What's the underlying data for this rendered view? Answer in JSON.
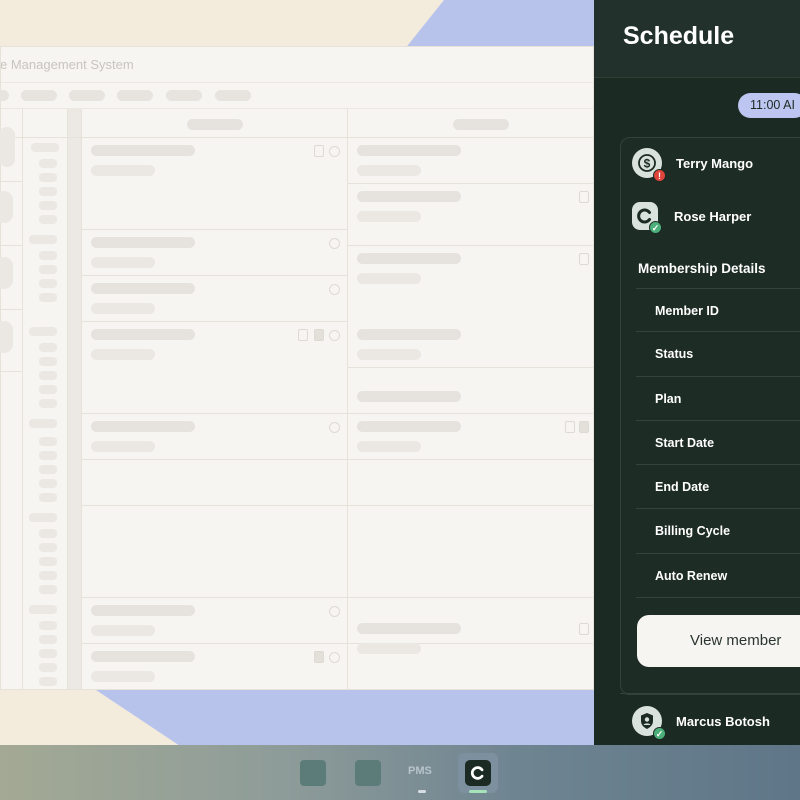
{
  "pms_window": {
    "title": "tice Management System"
  },
  "schedule": {
    "title": "Schedule",
    "time_chip": "11:00 AI",
    "people": [
      {
        "name": "Terry Mango",
        "icon": "dollar-icon",
        "badge": "!"
      },
      {
        "name": "Rose Harper",
        "icon": "c-logo-icon",
        "badge": "✓"
      }
    ],
    "membership": {
      "title": "Membership Details",
      "fields": [
        "Member ID",
        "Status",
        "Plan",
        "Start Date",
        "End Date",
        "Billing Cycle",
        "Auto Renew"
      ]
    },
    "view_button": "View member",
    "next_person": {
      "name": "Marcus Botosh",
      "icon": "user-shield-icon",
      "badge": "✓"
    }
  },
  "taskbar": {
    "label": "PMS",
    "colors": {
      "active_indicator": "#a6e3b8",
      "indicator": "#d6dde3"
    }
  },
  "colors": {
    "panel_bg": "#1c2a24",
    "chip_bg": "#bcc6f0",
    "background_cream": "#f3ecdc",
    "background_blue": "#b8c3ec"
  }
}
